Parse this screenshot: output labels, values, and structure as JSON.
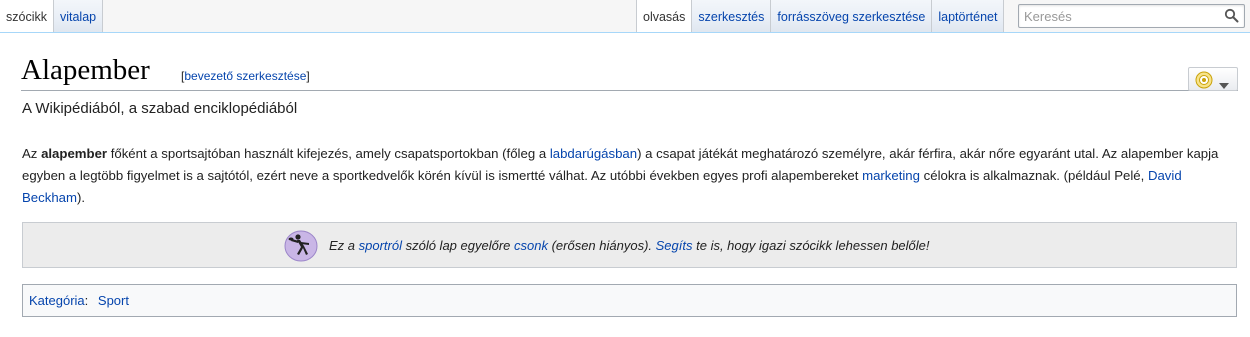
{
  "tabs": {
    "left": [
      {
        "label": "szócikk",
        "selected": true
      },
      {
        "label": "vitalap",
        "selected": false
      }
    ],
    "right": [
      {
        "label": "olvasás",
        "selected": true
      },
      {
        "label": "szerkesztés",
        "selected": false
      },
      {
        "label": "forrásszöveg szerkesztése",
        "selected": false
      },
      {
        "label": "laptörténet",
        "selected": false
      }
    ]
  },
  "search": {
    "placeholder": "Keresés",
    "button_icon": "magnifier-icon"
  },
  "page": {
    "title": "Alapember",
    "edit_section": {
      "open": "[",
      "label": "bevezető szerkesztése",
      "close": "]"
    },
    "tagline": "A Wikipédiából, a szabad enciklopédiából",
    "watch_icon": "eye-icon",
    "paragraph": {
      "p1": "Az ",
      "bold": "alapember",
      "p2": " főként a sportsajtóban használt kifejezés, amely csapatsportokban (főleg a ",
      "link1": "labdarúgásban",
      "p3": ") a csapat játékát meghatározó személyre, akár férfira, akár nőre egyaránt utal. Az alapember kapja egyben a legtöbb figyelmet is a sajtótól, ezért neve a sportkedvelők körén kívül is ismertté válhat. Az utóbbi években egyes profi alapembereket ",
      "link2": "marketing",
      "p4": " célokra is alkalmaznak. (például Pelé, ",
      "link3": "David Beckham",
      "p5": ")."
    }
  },
  "stub": {
    "icon": "discus-thrower-icon",
    "t1": "Ez a ",
    "link1": "sportról",
    "t2": " szóló lap egyelőre ",
    "link2": "csonk",
    "t3": " (erősen hiányos). ",
    "link3": "Segíts",
    "t4": " te is, hogy igazi szócikk lehessen belőle!"
  },
  "categories": {
    "label": "Kategória",
    "separator": ":",
    "items": [
      "Sport"
    ]
  },
  "colors": {
    "link": "#0645ad",
    "stub_bg": "#ececec",
    "tab_border": "#c8ccd1",
    "content_border": "#a7d7f9"
  }
}
